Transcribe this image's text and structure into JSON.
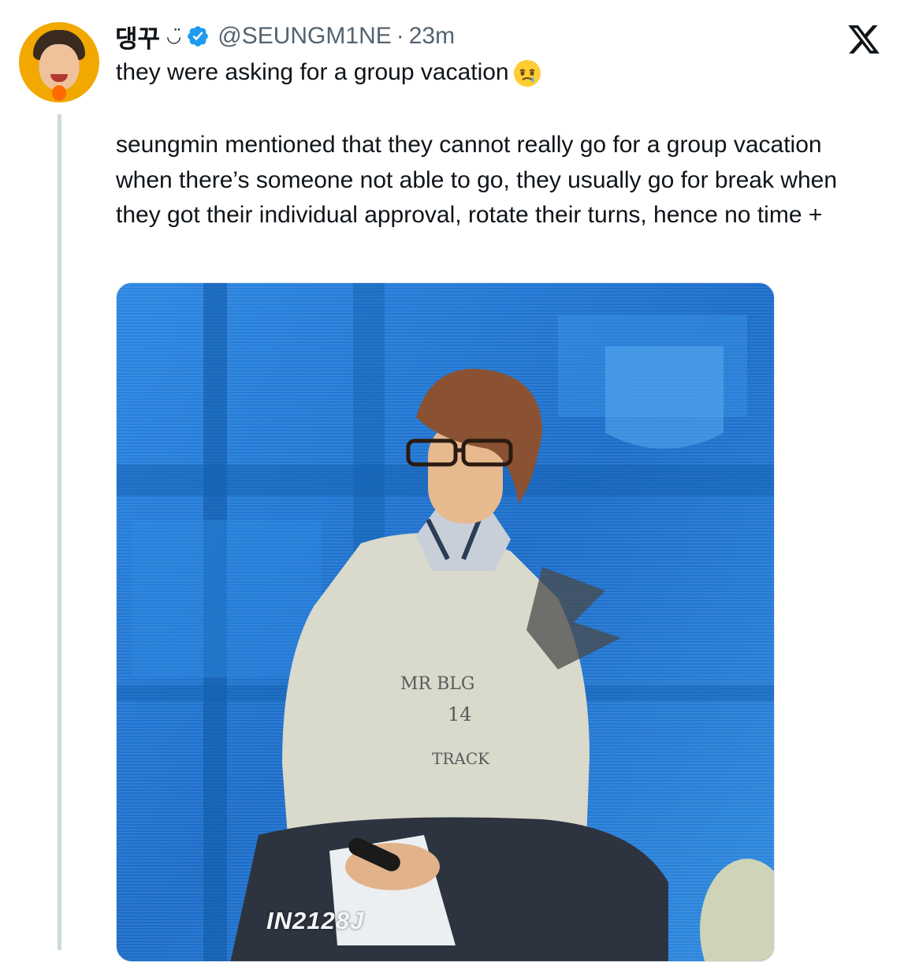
{
  "tweet": {
    "display_name": "댕꾸",
    "name_emoji": "◡̈",
    "verified": true,
    "handle": "@SEUNGM1NE",
    "separator": "·",
    "time": "23m",
    "line1": "they were asking for a group vacation",
    "line1_emoji": "face-holding-back-tears-icon",
    "body": "seungmin mentioned that they cannot really go for a group vacation when there’s someone not able to go, they usually go for break when they got their individual approval, rotate their turns, hence no time +"
  },
  "media": {
    "watermark": "IN2128J",
    "shirt_text_1": "MR BLG",
    "shirt_text_2": "14",
    "shirt_text_3": "TRACK"
  },
  "colors": {
    "verified_blue": "#1d9bf0",
    "secondary_text": "#536471",
    "thread_line": "#cfd9de",
    "screen_blue": "#1f7ad6"
  },
  "icons": {
    "brand": "x-logo-icon",
    "verified": "verified-badge-icon"
  }
}
